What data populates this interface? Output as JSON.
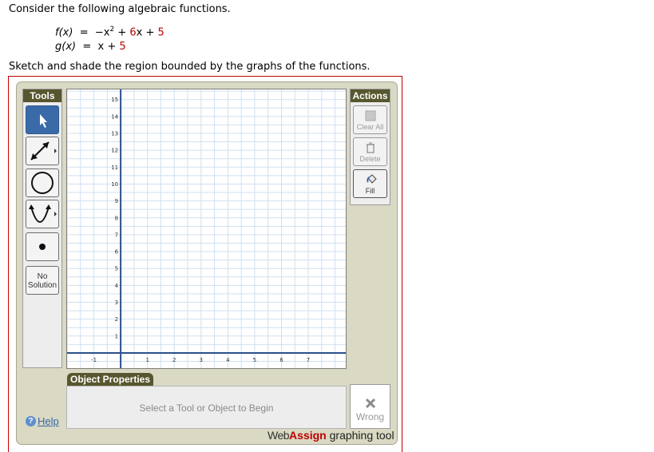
{
  "question": {
    "intro": "Consider the following algebraic functions.",
    "f": {
      "name": "f(x)",
      "eq": "=",
      "pre": "−x",
      "exp": "2",
      "plus1": " + ",
      "coef": "6",
      "x": "x + ",
      "const": "5"
    },
    "g": {
      "name": "g(x)",
      "eq": "=",
      "pre": "x + ",
      "const": "5"
    },
    "task": "Sketch and shade the region bounded by the graphs of the functions."
  },
  "tools": {
    "header": "Tools",
    "items": [
      {
        "name": "pointer-tool",
        "icon": "pointer-icon",
        "selected": true
      },
      {
        "name": "line-tool",
        "icon": "line-icon"
      },
      {
        "name": "circle-tool",
        "icon": "circle-icon"
      },
      {
        "name": "parabola-tool",
        "icon": "parabola-icon"
      },
      {
        "name": "point-tool",
        "icon": "point-icon"
      }
    ],
    "no_solution_line1": "No",
    "no_solution_line2": "Solution"
  },
  "graph": {
    "x_ticks": [
      "-1",
      "1",
      "2",
      "3",
      "4",
      "5",
      "6",
      "7"
    ],
    "y_ticks": [
      "1",
      "2",
      "3",
      "4",
      "5",
      "6",
      "7",
      "8",
      "9",
      "10",
      "11",
      "12",
      "13",
      "14",
      "15"
    ],
    "xlim": [
      -2,
      8.4
    ],
    "ylim": [
      -0.9,
      15.6
    ]
  },
  "actions": {
    "header": "Actions",
    "clear_all": "Clear All",
    "delete": "Delete",
    "fill": "Fill"
  },
  "object_properties": {
    "header": "Object Properties",
    "placeholder": "Select a Tool or Object to Begin"
  },
  "status": {
    "wrong": "Wrong"
  },
  "help": "Help",
  "brand": {
    "web": "Web",
    "assign": "Assign",
    "suffix": " graphing tool"
  },
  "colors": {
    "accent_red": "#c00000",
    "header_olive": "#57572f",
    "panel_bg": "#d9d9c4",
    "grid": "#cfe0f0",
    "axis": "#2c4f8a"
  }
}
